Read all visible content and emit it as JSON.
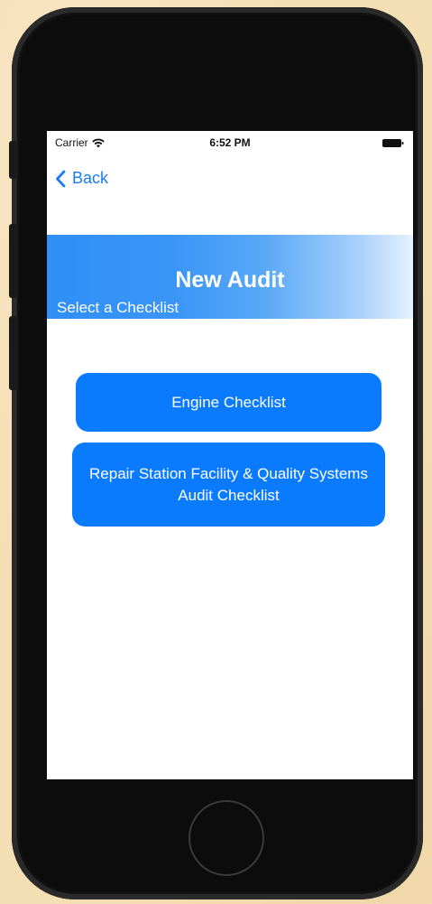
{
  "status_bar": {
    "carrier": "Carrier",
    "time": "6:52 PM"
  },
  "nav": {
    "back_label": "Back"
  },
  "header": {
    "title": "New Audit",
    "subtitle": "Select a Checklist"
  },
  "checklists": [
    {
      "label": "Engine Checklist"
    },
    {
      "label": "Repair Station Facility & Quality Systems Audit Checklist"
    }
  ],
  "colors": {
    "accent": "#0a7bff",
    "back_link": "#1a7cf5",
    "banner_start": "#2f8ff5",
    "banner_end": "#e6f1fe",
    "device": "#0c0c0c",
    "background": "#f4deb4"
  },
  "icons": {
    "wifi": "wifi-icon",
    "battery": "battery-icon",
    "back": "chevron-left-icon"
  }
}
